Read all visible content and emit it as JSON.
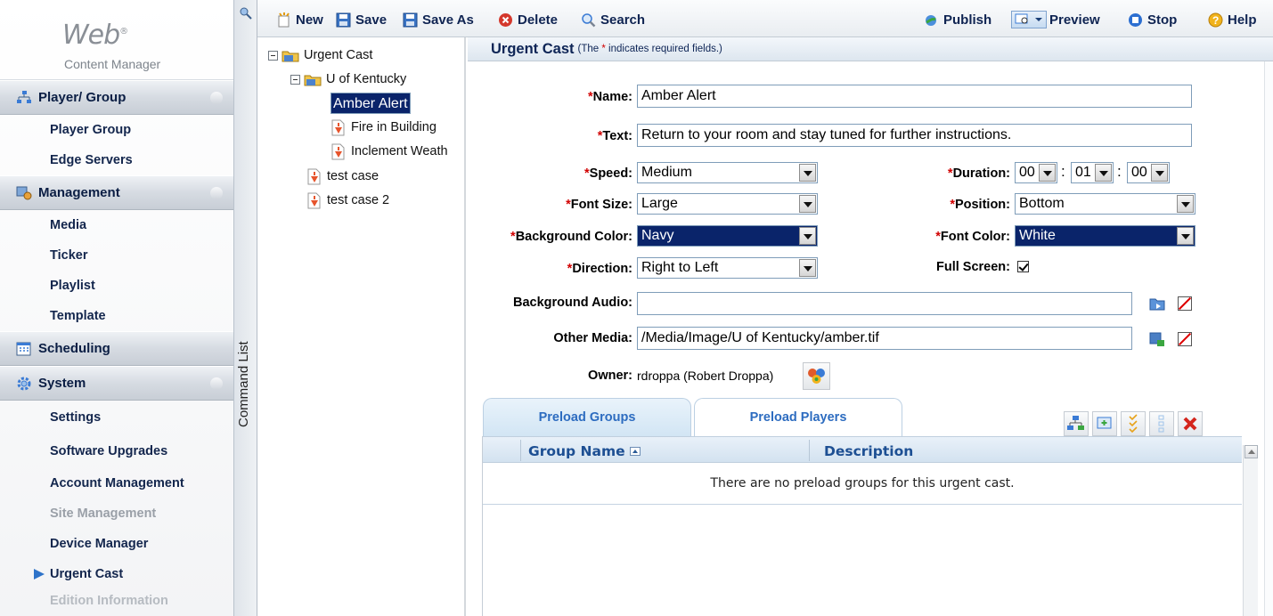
{
  "logo": {
    "title": "Web",
    "subtitle": "Content Manager"
  },
  "nav": {
    "groups": [
      {
        "label": "Player/ Group",
        "items": [
          "Player  Group",
          "Edge Servers"
        ]
      },
      {
        "label": "Management",
        "items": [
          "Media",
          "Ticker",
          "Playlist",
          "Template"
        ]
      },
      {
        "label": "Scheduling",
        "items": []
      },
      {
        "label": "System",
        "items": [
          "Settings",
          "Software Upgrades",
          "Account Management",
          "Site Management",
          "Device Manager",
          "Urgent Cast",
          "Edition Information"
        ]
      }
    ]
  },
  "command_list": {
    "label": "Command List"
  },
  "toolbar": {
    "new": "New",
    "save": "Save",
    "save_as": "Save As",
    "delete": "Delete",
    "search": "Search",
    "publish": "Publish",
    "preview": "Preview",
    "stop": "Stop",
    "help": "Help"
  },
  "tree": {
    "root": "Urgent Cast",
    "folder": "U of Kentucky",
    "children": [
      "Amber Alert",
      "Fire in Building",
      "Inclement Weath"
    ],
    "siblings": [
      "test case",
      "test case 2"
    ]
  },
  "form": {
    "title": "Urgent Cast",
    "note_prefix": "(The ",
    "note_star": "*",
    "note_suffix": " indicates required fields.)",
    "labels": {
      "name": "Name:",
      "text": "Text:",
      "speed": "Speed:",
      "font_size": "Font Size:",
      "background_color": "Background Color:",
      "direction": "Direction:",
      "duration": "Duration:",
      "position": "Position:",
      "font_color": "Font Color:",
      "full_screen": "Full Screen:",
      "background_audio": "Background Audio:",
      "other_media": "Other Media:",
      "owner": "Owner:"
    },
    "name": "Amber Alert",
    "text": "Return to your room and stay tuned for further instructions.",
    "speed": "Medium",
    "font_size": "Large",
    "background_color": "Navy",
    "direction": "Right to Left",
    "duration": {
      "h": "00",
      "m": "01",
      "s": "00"
    },
    "position": "Bottom",
    "font_color": "White",
    "full_screen": true,
    "background_audio": "",
    "other_media": "/Media/Image/U of Kentucky/amber.tif",
    "owner": "rdroppa (Robert Droppa)",
    "required_star": "*"
  },
  "tabs": [
    "Preload Groups",
    "Preload Players"
  ],
  "grid": {
    "columns": [
      "Group Name",
      "Description"
    ],
    "empty_message": "There are no preload groups for this urgent cast."
  },
  "colors": {
    "accent": "#2d6cc0",
    "selection": "#0a246a",
    "required": "#d10000",
    "nav_text": "#13264d"
  }
}
